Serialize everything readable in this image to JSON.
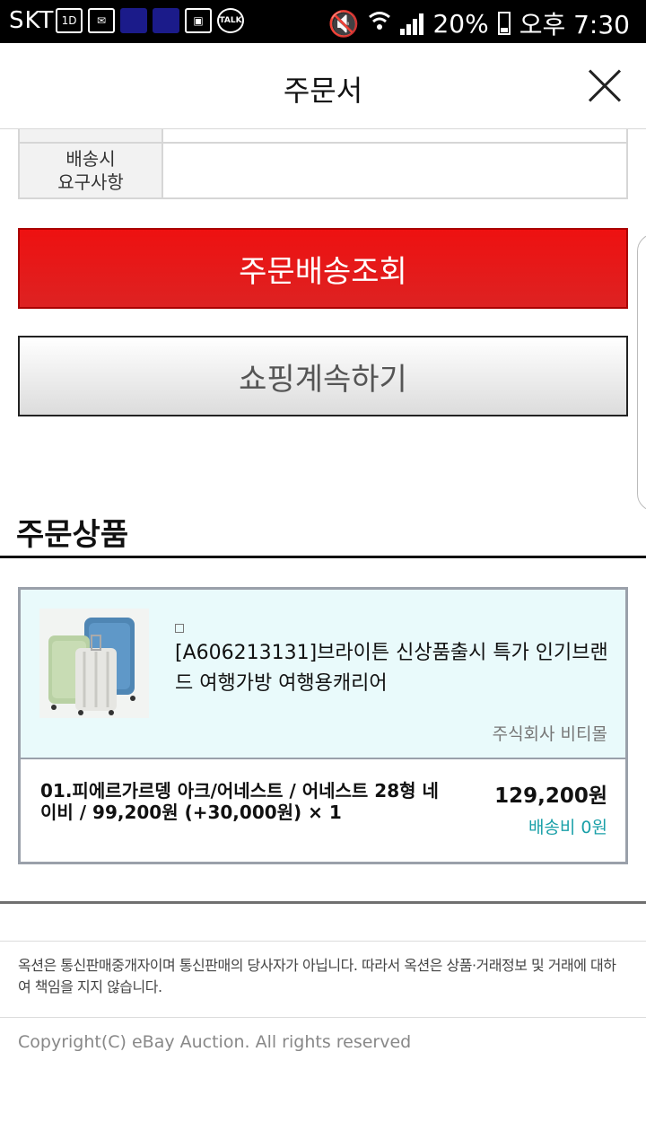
{
  "status_bar": {
    "carrier": "SKT",
    "battery": "20%",
    "time": "오후 7:30",
    "icons": [
      "lte-icon",
      "mail-icon",
      "app-icon",
      "app-icon",
      "image-icon",
      "talk-icon",
      "mute-icon",
      "wifi-icon",
      "signal-icon",
      "battery-icon"
    ],
    "talk_label": "TALK",
    "lte_label": "1D"
  },
  "header": {
    "title": "주문서"
  },
  "request": {
    "label": "배송시\n요구사항",
    "value": ""
  },
  "buttons": {
    "track_label": "주문배송조회",
    "continue_label": "쇼핑계속하기"
  },
  "section": {
    "title": "주문상품"
  },
  "product": {
    "title": "[A606213131]브라이튼 신상품출시 특가 인기브랜드 여행가방 여행용캐리어",
    "seller": "주식회사 비티몰",
    "option": "01.피에르가르뎅 아크/어네스트 / 어네스트 28형 네이비 / 99,200원 (+30,000원) × 1",
    "price": "129,200원",
    "shipping": "배송비 0원"
  },
  "footer": {
    "notice": "옥션은 통신판매중개자이며 통신판매의 당사자가 아닙니다. 따라서 옥션은 상품·거래정보 및 거래에 대하여 책임을 지지 않습니다.",
    "copyright": "Copyright(C) eBay Auction. All rights reserved"
  },
  "colors": {
    "accent_red": "#ee1111",
    "card_bg": "#e9fafb",
    "shipping_teal": "#1aa0a8"
  }
}
